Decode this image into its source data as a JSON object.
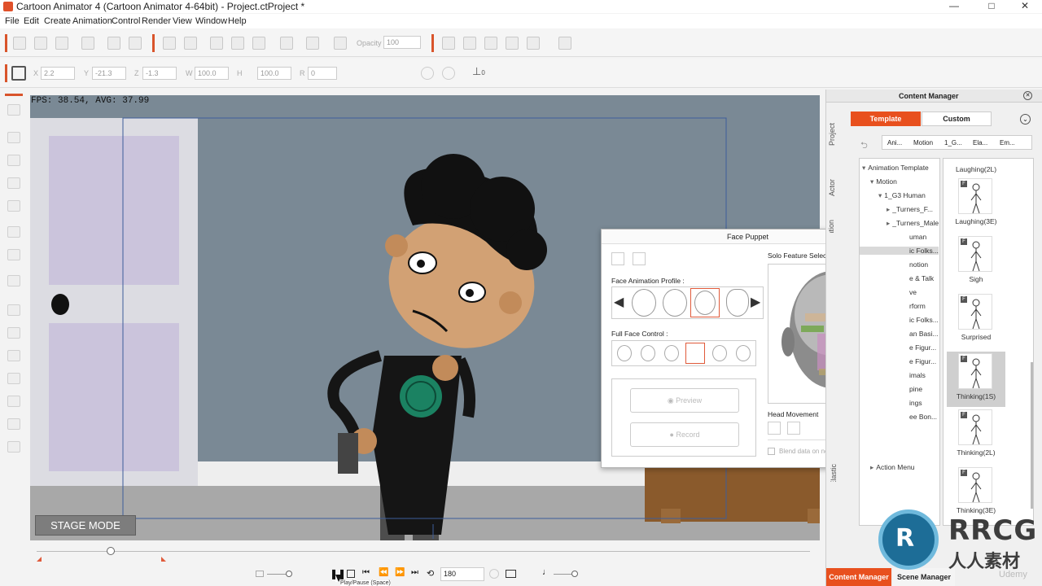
{
  "window": {
    "title": "Cartoon Animator 4  (Cartoon Animator 4-64bit) - Project.ctProject *",
    "controls": [
      "—",
      "□",
      "✕"
    ]
  },
  "menu": [
    "File",
    "Edit",
    "Create",
    "Animation",
    "Control",
    "Render",
    "View",
    "Window",
    "Help"
  ],
  "toolbar": {
    "opacity_label": "Opacity",
    "opacity_value": "100"
  },
  "transform": {
    "x_label": "X",
    "x_value": "2.2",
    "y_label": "Y",
    "y_value": "-21.3",
    "z_label": "Z",
    "z_value": "-1.3",
    "w_label": "W",
    "w_value": "100.0",
    "h_label": "H",
    "h_value": "100.0",
    "r_label": "R",
    "r_value": "0",
    "flip_value": "0"
  },
  "viewport": {
    "fps_text": "FPS: 38.54, AVG: 37.99",
    "stage_mode": "STAGE MODE"
  },
  "timeline": {
    "frame_value": "180",
    "tooltip": "Play/Pause (Space)"
  },
  "content_manager": {
    "title": "Content Manager",
    "side_tabs": [
      "Project",
      "Actor",
      "Animation",
      "Elastic"
    ],
    "tabs": [
      "Template",
      "Custom"
    ],
    "breadcrumb": [
      "Ani...",
      "Motion",
      "1_G...",
      "Ela...",
      "Em..."
    ],
    "tree": [
      {
        "label": "Animation Template",
        "depth": 0,
        "arrow": "▾"
      },
      {
        "label": "Motion",
        "depth": 1,
        "arrow": "▾"
      },
      {
        "label": "1_G3 Human",
        "depth": 2,
        "arrow": "▾"
      },
      {
        "label": "_Turners_F...",
        "depth": 3,
        "arrow": "▸"
      },
      {
        "label": "_Turners_Male",
        "depth": 3,
        "arrow": "▸"
      },
      {
        "label": "uman",
        "depth": 4,
        "arrow": ""
      },
      {
        "label": "ic Folks...",
        "depth": 4,
        "arrow": ""
      },
      {
        "label": "notion",
        "depth": 4,
        "arrow": ""
      },
      {
        "label": "e & Talk",
        "depth": 4,
        "arrow": ""
      },
      {
        "label": "ve",
        "depth": 4,
        "arrow": ""
      },
      {
        "label": "rform",
        "depth": 4,
        "arrow": ""
      },
      {
        "label": "ic Folks...",
        "depth": 4,
        "arrow": ""
      },
      {
        "label": "an Basi...",
        "depth": 4,
        "arrow": ""
      },
      {
        "label": "e Figur...",
        "depth": 4,
        "arrow": ""
      },
      {
        "label": "e Figur...",
        "depth": 4,
        "arrow": ""
      },
      {
        "label": "imals",
        "depth": 4,
        "arrow": ""
      },
      {
        "label": "pine",
        "depth": 4,
        "arrow": ""
      },
      {
        "label": "ings",
        "depth": 4,
        "arrow": ""
      },
      {
        "label": "ee Bon...",
        "depth": 4,
        "arrow": ""
      },
      {
        "label": "Action Menu",
        "depth": 1,
        "arrow": "▸"
      }
    ],
    "thumbnails": [
      {
        "label": "Laughing(2L)"
      },
      {
        "label": "Laughing(3E)"
      },
      {
        "label": "Sigh"
      },
      {
        "label": "Surprised"
      },
      {
        "label": "Thinking(1S)"
      },
      {
        "label": "Thinking(2L)"
      },
      {
        "label": "Thinking(3E)"
      }
    ],
    "bottom_tabs": [
      "Content Manager",
      "Scene Manager"
    ]
  },
  "face_puppet": {
    "title": "Face Puppet",
    "profile_label": "Face Animation Profile :",
    "full_face_label": "Full Face Control :",
    "preview_label": "Preview",
    "record_label": "Record",
    "solo_label": "Solo Feature Selection",
    "head_movement_label": "Head Movement",
    "blend_label": "Blend data on next recording"
  },
  "watermark": {
    "brand": "RRCG",
    "sub": "人人素材",
    "udemy": "Udemy"
  },
  "colors": {
    "accent": "#e8501e",
    "viewport_bg": "#7a8995",
    "floor": "#a9a9a9",
    "door": "#d9d9e1",
    "door_panel": "#cdc6dd"
  }
}
